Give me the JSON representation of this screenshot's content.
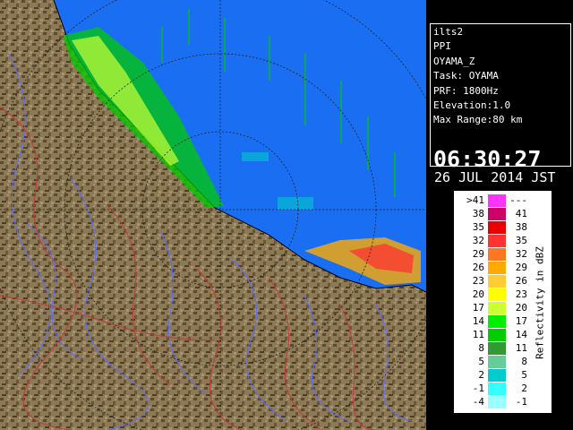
{
  "info": {
    "lines": [
      "ilts2",
      "PPI",
      "OYAMA_Z",
      "Task: OYAMA",
      "PRF: 1800Hz",
      "Elevation:1.0",
      "Max Range:80 km"
    ],
    "time": "06:30:27",
    "date": "26 JUL 2014 JST"
  },
  "legend": {
    "unit": "Reflectivity in dBZ",
    "rows": [
      {
        "lo": ">41",
        "hi": "---",
        "color": "#ff33ff"
      },
      {
        "lo": "38",
        "hi": "41",
        "color": "#cc0066"
      },
      {
        "lo": "35",
        "hi": "38",
        "color": "#e80000"
      },
      {
        "lo": "32",
        "hi": "35",
        "color": "#ff3333"
      },
      {
        "lo": "29",
        "hi": "32",
        "color": "#ff7722"
      },
      {
        "lo": "26",
        "hi": "29",
        "color": "#ffaa00"
      },
      {
        "lo": "23",
        "hi": "26",
        "color": "#ffcc33"
      },
      {
        "lo": "20",
        "hi": "23",
        "color": "#ffff00"
      },
      {
        "lo": "17",
        "hi": "20",
        "color": "#ccff33"
      },
      {
        "lo": "14",
        "hi": "17",
        "color": "#00ee00"
      },
      {
        "lo": "11",
        "hi": "14",
        "color": "#00cc00"
      },
      {
        "lo": "8",
        "hi": "11",
        "color": "#339933"
      },
      {
        "lo": "5",
        "hi": "8",
        "color": "#66cc99"
      },
      {
        "lo": "2",
        "hi": "5",
        "color": "#00cccc"
      },
      {
        "lo": "-1",
        "hi": "2",
        "color": "#33ffff"
      },
      {
        "lo": "-4",
        "hi": "-1",
        "color": "#99ffff"
      }
    ]
  },
  "colors": {
    "sea": "#1a6ef2",
    "land": "#8b7a55",
    "land_dark": "#5e4a2c",
    "background": "#000000",
    "rivers": "#5b6cff",
    "boundaries": "#c23a3a"
  }
}
